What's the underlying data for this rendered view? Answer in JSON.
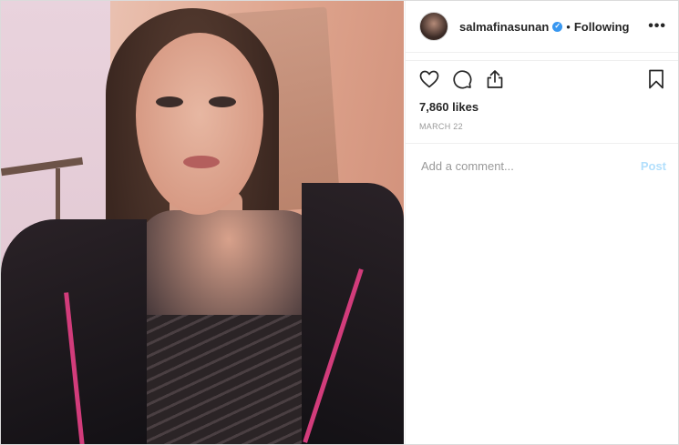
{
  "post": {
    "username": "salmafinasunan",
    "separator": "•",
    "follow_status": "Following",
    "more_label": "•••",
    "likes": "7,860 likes",
    "date": "MARCH 22"
  },
  "comment": {
    "placeholder": "Add a comment...",
    "post_label": "Post"
  },
  "icons": {
    "like": "heart-icon",
    "comment": "comment-icon",
    "share": "share-icon",
    "save": "bookmark-icon",
    "verified": "verified-badge-icon"
  },
  "colors": {
    "text": "#262626",
    "muted": "#999999",
    "verified": "#3897f0",
    "post_disabled": "#b2dffc"
  }
}
